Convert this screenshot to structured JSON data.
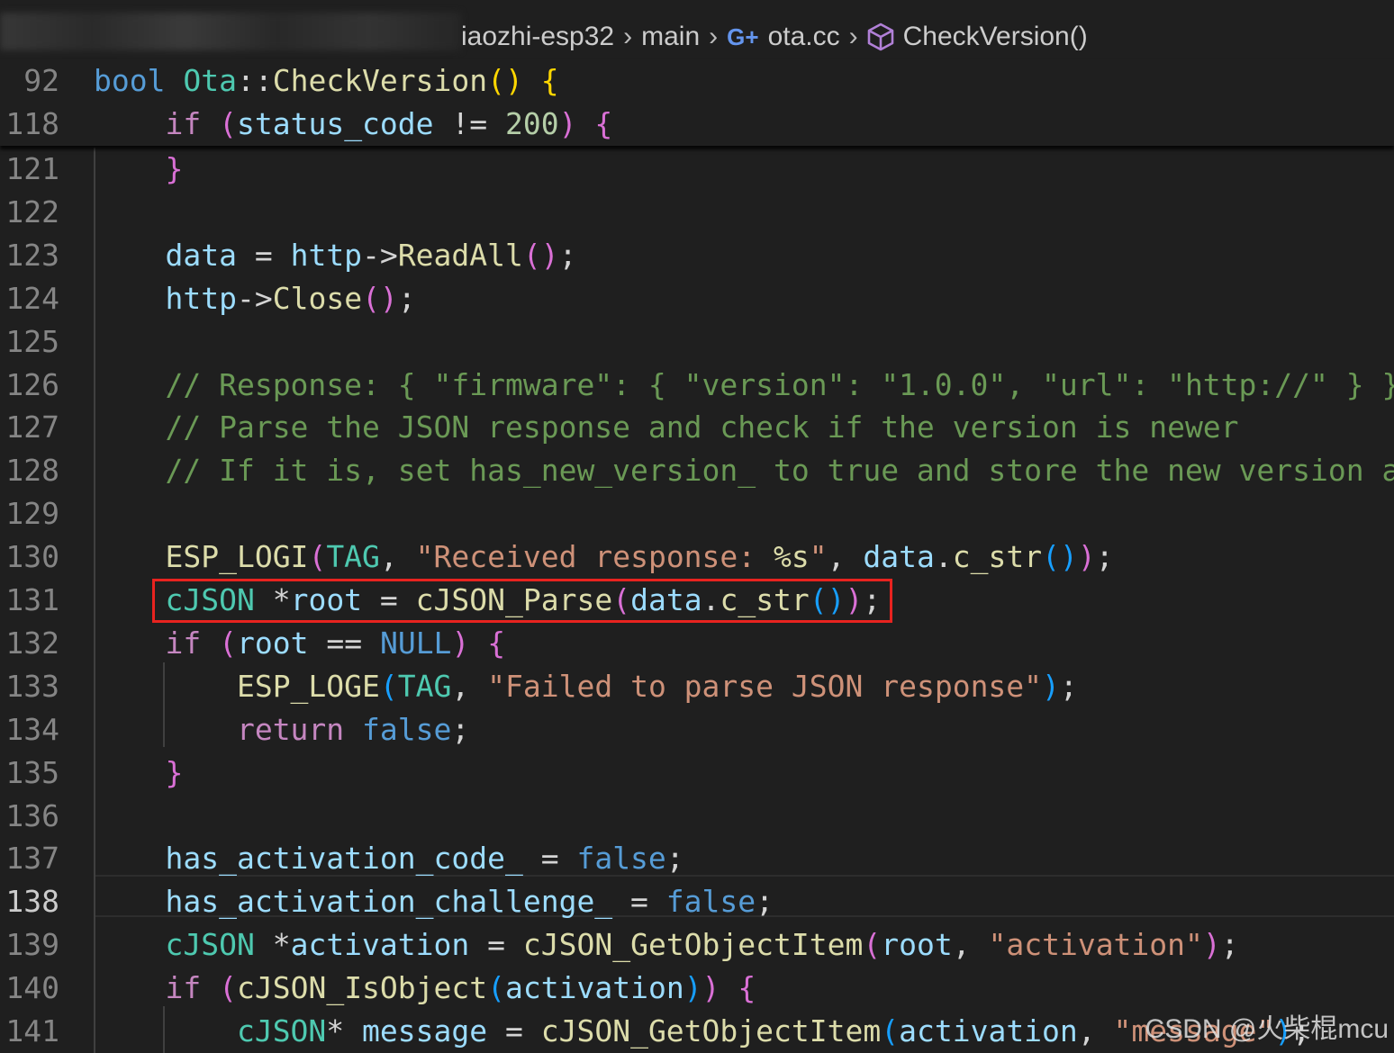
{
  "breadcrumb": {
    "folder": "iaozhi-esp32",
    "subfolder": "main",
    "file": "ota.cc",
    "symbol": "CheckVersion()"
  },
  "colors": {
    "background": "#1f1f1f",
    "keyword": "#569cd6",
    "control": "#c586c0",
    "function": "#dcdcaa",
    "variable": "#9cdcfe",
    "type": "#4ec9b0",
    "string": "#ce9178",
    "number": "#b5cea8",
    "comment": "#6a9955",
    "highlight_box": "#e8231f"
  },
  "editor": {
    "active_line": "138",
    "highlighted_line": "131",
    "sticky_lines": [
      {
        "num": "92",
        "tokens": [
          [
            "bool",
            "kw"
          ],
          [
            " ",
            "p"
          ],
          [
            "Ota",
            "ty"
          ],
          [
            "::",
            "p"
          ],
          [
            "CheckVersion",
            "fn"
          ],
          [
            "()",
            "b1"
          ],
          [
            " ",
            "p"
          ],
          [
            "{",
            "b1"
          ]
        ]
      },
      {
        "num": "118",
        "tokens": [
          [
            "    ",
            "p"
          ],
          [
            "if",
            "ctl"
          ],
          [
            " ",
            "p"
          ],
          [
            "(",
            "b2"
          ],
          [
            "status_code",
            "v"
          ],
          [
            " != ",
            "p"
          ],
          [
            "200",
            "num"
          ],
          [
            ")",
            "b2"
          ],
          [
            " ",
            "p"
          ],
          [
            "{",
            "b2"
          ]
        ]
      }
    ],
    "lines": [
      {
        "num": "121",
        "tokens": [
          [
            "    ",
            "p"
          ],
          [
            "}",
            "b2"
          ]
        ]
      },
      {
        "num": "122",
        "tokens": []
      },
      {
        "num": "123",
        "tokens": [
          [
            "    ",
            "p"
          ],
          [
            "data",
            "v"
          ],
          [
            " = ",
            "p"
          ],
          [
            "http",
            "v"
          ],
          [
            "->",
            "p"
          ],
          [
            "ReadAll",
            "fn"
          ],
          [
            "()",
            "b2"
          ],
          [
            ";",
            "p"
          ]
        ]
      },
      {
        "num": "124",
        "tokens": [
          [
            "    ",
            "p"
          ],
          [
            "http",
            "v"
          ],
          [
            "->",
            "p"
          ],
          [
            "Close",
            "fn"
          ],
          [
            "()",
            "b2"
          ],
          [
            ";",
            "p"
          ]
        ]
      },
      {
        "num": "125",
        "tokens": []
      },
      {
        "num": "126",
        "tokens": [
          [
            "    ",
            "p"
          ],
          [
            "// Response: { \"firmware\": { \"version\": \"1.0.0\", \"url\": \"http://\" } }",
            "cm"
          ]
        ]
      },
      {
        "num": "127",
        "tokens": [
          [
            "    ",
            "p"
          ],
          [
            "// Parse the JSON response and check if the version is newer",
            "cm"
          ]
        ]
      },
      {
        "num": "128",
        "tokens": [
          [
            "    ",
            "p"
          ],
          [
            "// If it is, set has_new_version_ to true and store the new version and",
            "cm"
          ]
        ]
      },
      {
        "num": "129",
        "tokens": []
      },
      {
        "num": "130",
        "tokens": [
          [
            "    ",
            "p"
          ],
          [
            "ESP_LOGI",
            "fn"
          ],
          [
            "(",
            "b2"
          ],
          [
            "TAG",
            "ty"
          ],
          [
            ", ",
            "p"
          ],
          [
            "\"Received response: ",
            "str"
          ],
          [
            "%s",
            "fn"
          ],
          [
            "\"",
            "str"
          ],
          [
            ", ",
            "p"
          ],
          [
            "data",
            "v"
          ],
          [
            ".",
            "p"
          ],
          [
            "c_str",
            "fn"
          ],
          [
            "()",
            "b3"
          ],
          [
            ")",
            "b2"
          ],
          [
            ";",
            "p"
          ]
        ]
      },
      {
        "num": "131",
        "tokens": [
          [
            "    ",
            "p"
          ],
          [
            "cJSON",
            "ty"
          ],
          [
            " *",
            "p"
          ],
          [
            "root",
            "v"
          ],
          [
            " = ",
            "p"
          ],
          [
            "cJSON_Parse",
            "fn"
          ],
          [
            "(",
            "b2"
          ],
          [
            "data",
            "v"
          ],
          [
            ".",
            "p"
          ],
          [
            "c_str",
            "fn"
          ],
          [
            "()",
            "b3"
          ],
          [
            ")",
            "b2"
          ],
          [
            ";",
            "p"
          ]
        ]
      },
      {
        "num": "132",
        "tokens": [
          [
            "    ",
            "p"
          ],
          [
            "if",
            "ctl"
          ],
          [
            " ",
            "p"
          ],
          [
            "(",
            "b2"
          ],
          [
            "root",
            "v"
          ],
          [
            " == ",
            "p"
          ],
          [
            "NULL",
            "kw"
          ],
          [
            ")",
            "b2"
          ],
          [
            " ",
            "p"
          ],
          [
            "{",
            "b2"
          ]
        ]
      },
      {
        "num": "133",
        "tokens": [
          [
            "        ",
            "p"
          ],
          [
            "ESP_LOGE",
            "fn"
          ],
          [
            "(",
            "b3"
          ],
          [
            "TAG",
            "ty"
          ],
          [
            ", ",
            "p"
          ],
          [
            "\"Failed to parse JSON response\"",
            "str"
          ],
          [
            ")",
            "b3"
          ],
          [
            ";",
            "p"
          ]
        ]
      },
      {
        "num": "134",
        "tokens": [
          [
            "        ",
            "p"
          ],
          [
            "return",
            "ctl"
          ],
          [
            " ",
            "p"
          ],
          [
            "false",
            "kw"
          ],
          [
            ";",
            "p"
          ]
        ]
      },
      {
        "num": "135",
        "tokens": [
          [
            "    ",
            "p"
          ],
          [
            "}",
            "b2"
          ]
        ]
      },
      {
        "num": "136",
        "tokens": []
      },
      {
        "num": "137",
        "tokens": [
          [
            "    ",
            "p"
          ],
          [
            "has_activation_code_",
            "v"
          ],
          [
            " = ",
            "p"
          ],
          [
            "false",
            "kw"
          ],
          [
            ";",
            "p"
          ]
        ]
      },
      {
        "num": "138",
        "tokens": [
          [
            "    ",
            "p"
          ],
          [
            "has_activation_challenge_",
            "v"
          ],
          [
            " = ",
            "p"
          ],
          [
            "false",
            "kw"
          ],
          [
            ";",
            "p"
          ]
        ]
      },
      {
        "num": "139",
        "tokens": [
          [
            "    ",
            "p"
          ],
          [
            "cJSON",
            "ty"
          ],
          [
            " *",
            "p"
          ],
          [
            "activation",
            "v"
          ],
          [
            " = ",
            "p"
          ],
          [
            "cJSON_GetObjectItem",
            "fn"
          ],
          [
            "(",
            "b2"
          ],
          [
            "root",
            "v"
          ],
          [
            ", ",
            "p"
          ],
          [
            "\"activation\"",
            "str"
          ],
          [
            ")",
            "b2"
          ],
          [
            ";",
            "p"
          ]
        ]
      },
      {
        "num": "140",
        "tokens": [
          [
            "    ",
            "p"
          ],
          [
            "if",
            "ctl"
          ],
          [
            " ",
            "p"
          ],
          [
            "(",
            "b2"
          ],
          [
            "cJSON_IsObject",
            "fn"
          ],
          [
            "(",
            "b3"
          ],
          [
            "activation",
            "v"
          ],
          [
            ")",
            "b3"
          ],
          [
            ")",
            "b2"
          ],
          [
            " ",
            "p"
          ],
          [
            "{",
            "b2"
          ]
        ]
      },
      {
        "num": "141",
        "tokens": [
          [
            "        ",
            "p"
          ],
          [
            "cJSON",
            "ty"
          ],
          [
            "* ",
            "p"
          ],
          [
            "message",
            "v"
          ],
          [
            " = ",
            "p"
          ],
          [
            "cJSON_GetObjectItem",
            "fn"
          ],
          [
            "(",
            "b3"
          ],
          [
            "activation",
            "v"
          ],
          [
            ", ",
            "p"
          ],
          [
            "\"message\"",
            "str"
          ],
          [
            ")",
            "b3"
          ],
          [
            ";",
            "p"
          ]
        ]
      }
    ]
  },
  "watermark": "CSDN @火柴棍mcu"
}
